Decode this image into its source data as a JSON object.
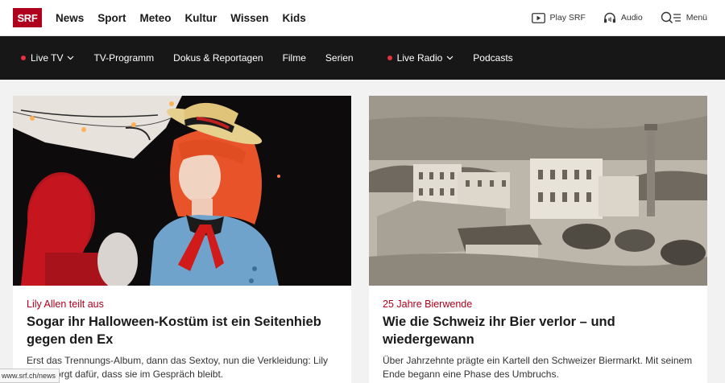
{
  "logo": {
    "text": "SRF"
  },
  "main_nav": {
    "items": [
      "News",
      "Sport",
      "Meteo",
      "Kultur",
      "Wissen",
      "Kids"
    ]
  },
  "utility_nav": {
    "play": {
      "label": "Play SRF",
      "icon": "play-icon"
    },
    "audio": {
      "label": "Audio",
      "icon": "headphones-icon"
    },
    "menu": {
      "label": "Menü",
      "icon": "search-menu-icon"
    }
  },
  "sub_nav": {
    "live_tv": "Live TV",
    "tv_programm": "TV-Programm",
    "dokus": "Dokus & Reportagen",
    "filme": "Filme",
    "serien": "Serien",
    "live_radio": "Live Radio",
    "podcasts": "Podcasts"
  },
  "cards": [
    {
      "kicker": "Lily Allen teilt aus",
      "headline": "Sogar ihr Halloween-Kostüm ist ein Seitenhieb gegen den Ex",
      "lead": "Erst das Trennungs-Album, dann das Sextoy, nun die Verkleidung: Lily Allen sorgt dafür, dass sie im Gespräch bleibt.",
      "image": "halloween-costume-photo"
    },
    {
      "kicker": "25 Jahre Bierwende",
      "headline": "Wie die Schweiz ihr Bier verlor – und wiedergewann",
      "lead": "Über Jahrzehnte prägte ein Kartell den Schweizer Biermarkt. Mit seinem Ende begann eine Phase des Umbruchs.",
      "image": "historic-brewery-illustration"
    }
  ],
  "status_bar": {
    "url": "www.srf.ch/news"
  },
  "colors": {
    "accent": "#af001d",
    "subnav_bg": "#171717",
    "live_dot": "#e3333d"
  }
}
